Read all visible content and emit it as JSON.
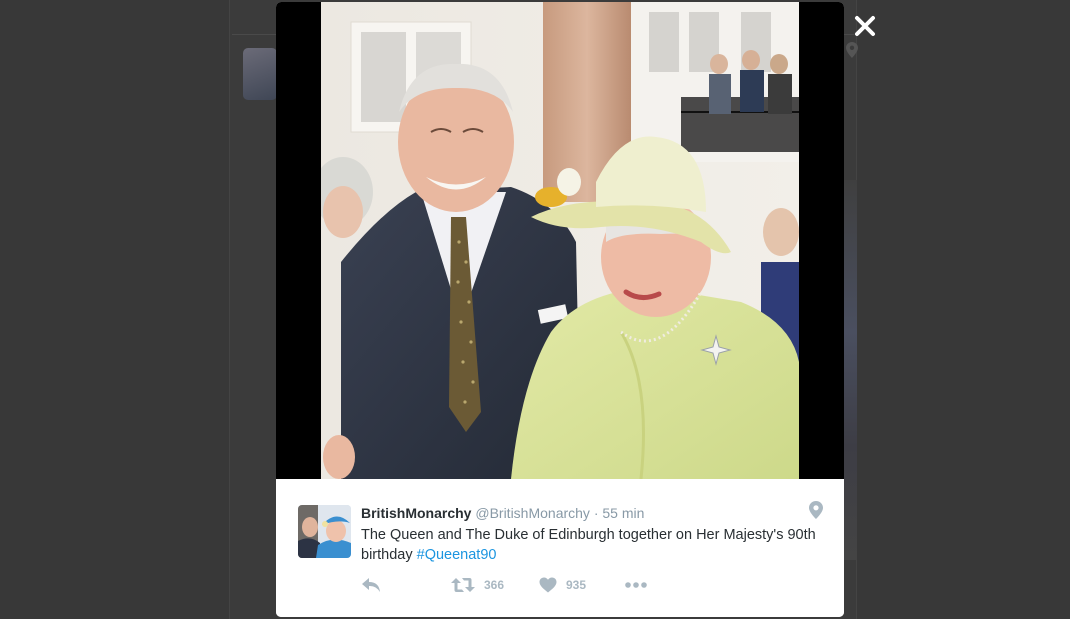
{
  "tweet": {
    "display_name": "BritishMonarchy",
    "handle": "@BritishMonarchy",
    "separator": "·",
    "time": "55 min",
    "text": "The Queen and The Duke of Edinburgh together on Her Majesty's 90th birthday ",
    "hashtag": "#Queenat90",
    "retweet_count": "366",
    "like_count": "935"
  },
  "icons": {
    "close": "close-icon",
    "location": "location-pin-icon",
    "reply": "reply-icon",
    "retweet": "retweet-icon",
    "like": "heart-icon",
    "more": "more-icon"
  },
  "colors": {
    "overlay": "#383838",
    "text": "#292f33",
    "muted": "#8899a6",
    "action": "#aab8c2",
    "link": "#1b95e0"
  }
}
